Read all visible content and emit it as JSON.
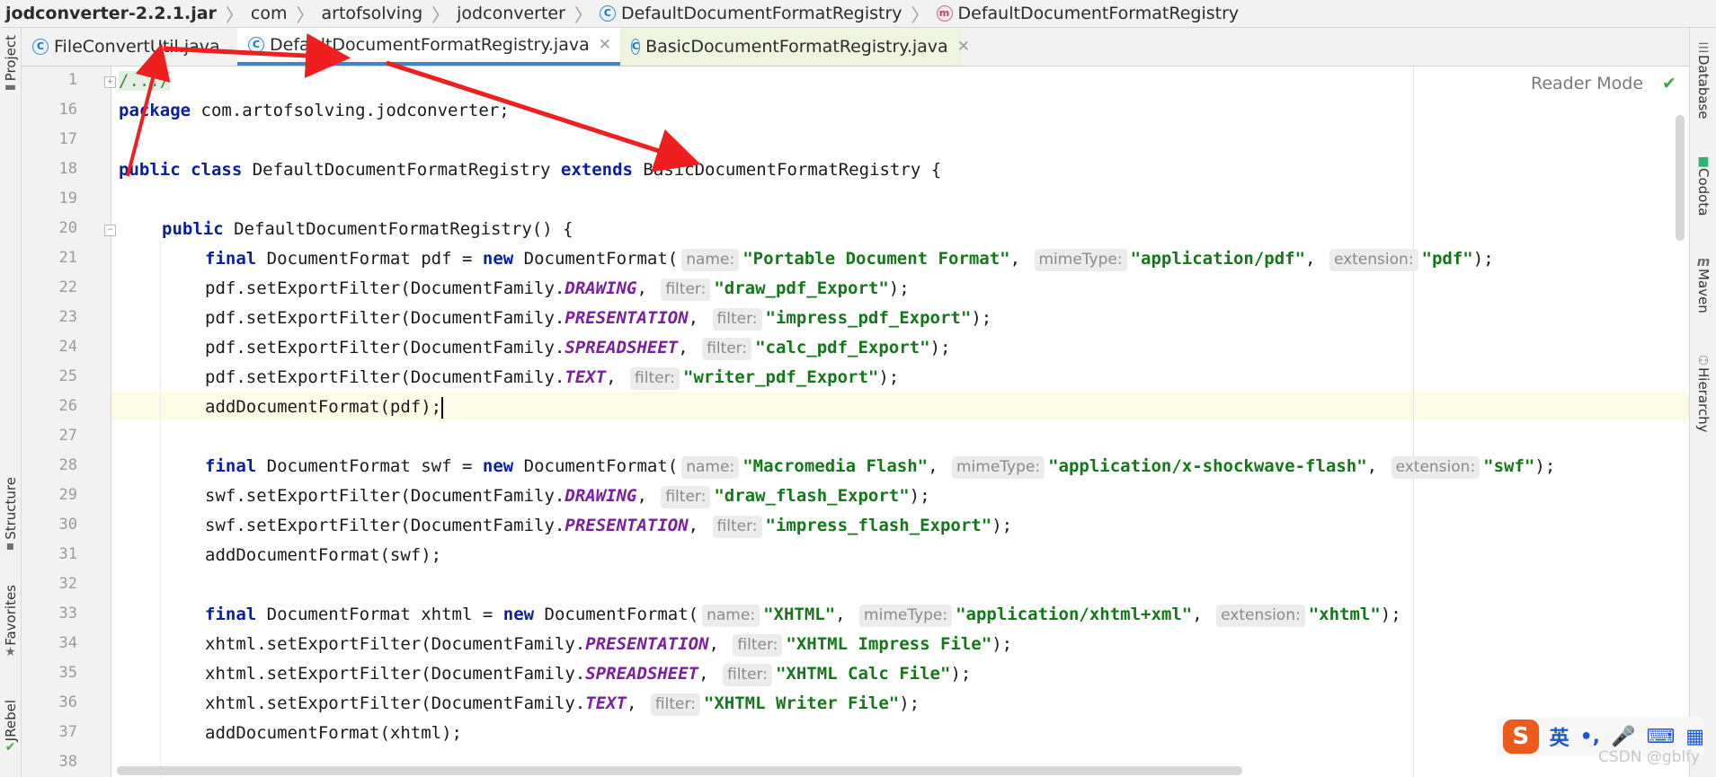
{
  "breadcrumb": {
    "jar": "jodconverter-2.2.1.jar",
    "p1": "com",
    "p2": "artofsolving",
    "p3": "jodconverter",
    "cls": "DefaultDocumentFormatRegistry",
    "method": "DefaultDocumentFormatRegistry"
  },
  "tabs": [
    {
      "label": "FileConvertUtil.java",
      "icon": "class-icon"
    },
    {
      "label": "DefaultDocumentFormatRegistry.java",
      "icon": "class-icon"
    },
    {
      "label": "BasicDocumentFormatRegistry.java",
      "icon": "class-icon"
    }
  ],
  "left_tools": {
    "project": "Project",
    "structure": "Structure",
    "favorites": "Favorites",
    "jrebel": "JRebel"
  },
  "right_tools": {
    "database": "Database",
    "codota": "Codota",
    "maven": "Maven",
    "hierarchy": "Hierarchy"
  },
  "editor": {
    "reader_mode": "Reader Mode",
    "line_numbers": [
      "1",
      "16",
      "17",
      "18",
      "19",
      "20",
      "21",
      "22",
      "23",
      "24",
      "25",
      "26",
      "27",
      "28",
      "29",
      "30",
      "31",
      "32",
      "33",
      "34",
      "35",
      "36",
      "37",
      "38"
    ],
    "l1_fold": "/.../",
    "l16_kw": "package",
    "l16_rest": " com.artofsolving.jodconverter;",
    "l18_kw1": "public class",
    "l18_mid": " DefaultDocumentFormatRegistry ",
    "l18_kw2": "extends",
    "l18_end": " BasicDocumentFormatRegistry {",
    "l20_kw": "public",
    "l20_rest": " DefaultDocumentFormatRegistry() {",
    "kw_final": "final",
    "kw_new": "new",
    "hint_name": "name:",
    "hint_mime": "mimeType:",
    "hint_ext": "extension:",
    "hint_filter": "filter:",
    "l21_a": " DocumentFormat pdf = ",
    "l21_b": " DocumentFormat(",
    "l21_name": "\"Portable Document Format\"",
    "l21_mime": "\"application/pdf\"",
    "l21_ext": "\"pdf\"",
    "l22_a": "pdf.setExportFilter(DocumentFamily.",
    "l22_c": "DRAWING",
    "l22_s": "\"draw_pdf_Export\"",
    "l23_a": "pdf.setExportFilter(DocumentFamily.",
    "l23_c": "PRESENTATION",
    "l23_s": "\"impress_pdf_Export\"",
    "l24_a": "pdf.setExportFilter(DocumentFamily.",
    "l24_c": "SPREADSHEET",
    "l24_s": "\"calc_pdf_Export\"",
    "l25_a": "pdf.setExportFilter(DocumentFamily.",
    "l25_c": "TEXT",
    "l25_s": "\"writer_pdf_Export\"",
    "l26": "addDocumentFormat(pdf);",
    "l28_a": " DocumentFormat swf = ",
    "l28_b": " DocumentFormat(",
    "l28_name": "\"Macromedia Flash\"",
    "l28_mime": "\"application/x-shockwave-flash\"",
    "l28_ext": "\"swf\"",
    "l29_a": "swf.setExportFilter(DocumentFamily.",
    "l29_c": "DRAWING",
    "l29_s": "\"draw_flash_Export\"",
    "l30_a": "swf.setExportFilter(DocumentFamily.",
    "l30_c": "PRESENTATION",
    "l30_s": "\"impress_flash_Export\"",
    "l31": "addDocumentFormat(swf);",
    "l33_a": " DocumentFormat xhtml = ",
    "l33_b": " DocumentFormat(",
    "l33_name": "\"XHTML\"",
    "l33_mime": "\"application/xhtml+xml\"",
    "l33_ext": "\"xhtml\"",
    "l34_a": "xhtml.setExportFilter(DocumentFamily.",
    "l34_c": "PRESENTATION",
    "l34_s": "\"XHTML Impress File\"",
    "l35_a": "xhtml.setExportFilter(DocumentFamily.",
    "l35_c": "SPREADSHEET",
    "l35_s": "\"XHTML Calc File\"",
    "l36_a": "xhtml.setExportFilter(DocumentFamily.",
    "l36_c": "TEXT",
    "l36_s": "\"XHTML Writer File\"",
    "l37": "addDocumentFormat(xhtml);"
  },
  "ime": {
    "lang": "英",
    "punct": "•,",
    "mic": "🎤",
    "kbd": "⌨",
    "grid": "▦"
  },
  "watermark": "CSDN @gblfy",
  "colors": {
    "accent": "#4083c9",
    "keyword": "#0a1f9c",
    "string": "#14781a",
    "constant": "#7a1fa0",
    "annotation_arrow": "#f01e1e"
  }
}
